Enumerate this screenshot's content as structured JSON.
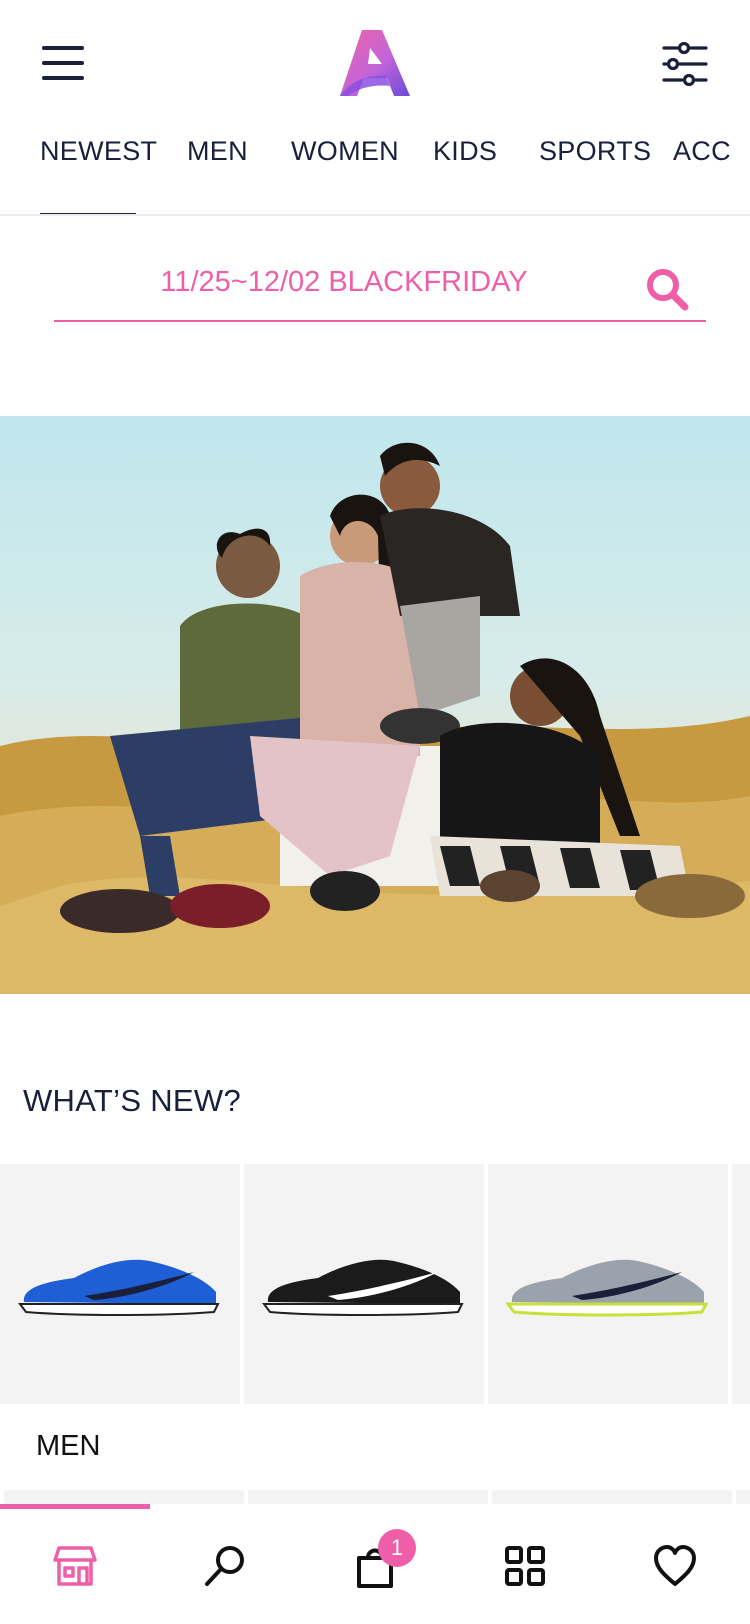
{
  "header": {
    "menu_icon": "hamburger-menu-icon",
    "logo": "A",
    "filter_icon": "sliders-icon"
  },
  "tabs": [
    {
      "label": "NEWEST",
      "active": true
    },
    {
      "label": "MEN",
      "active": false
    },
    {
      "label": "WOMEN",
      "active": false
    },
    {
      "label": "KIDS",
      "active": false
    },
    {
      "label": "SPORTS",
      "active": false
    },
    {
      "label": "ACC",
      "active": false
    }
  ],
  "search": {
    "placeholder": "11/25~12/02 BLACKFRIDAY",
    "icon": "search-icon"
  },
  "hero": {
    "alt": "Hero banner photo"
  },
  "whats_new": {
    "title": "WHAT’S NEW?",
    "products": [
      {
        "color": "#1e5fd6",
        "name": "blue-running-shoe"
      },
      {
        "color": "#1b1b1b",
        "name": "black-running-shoe"
      },
      {
        "color": "#9aa3ab",
        "name": "grey-running-shoe"
      }
    ]
  },
  "men_section": {
    "title": "MEN"
  },
  "bottom_nav": {
    "items": [
      {
        "name": "store",
        "icon": "store-icon",
        "active": true
      },
      {
        "name": "search",
        "icon": "search-icon",
        "active": false
      },
      {
        "name": "bag",
        "icon": "shopping-bag-icon",
        "active": false
      },
      {
        "name": "categories",
        "icon": "grid-icon",
        "active": false
      },
      {
        "name": "wishlist",
        "icon": "heart-icon",
        "active": false
      }
    ],
    "cart_count": "1"
  },
  "colors": {
    "accent": "#ee5fa8",
    "text": "#1a1f3a",
    "card_bg": "#f3f3f4"
  }
}
